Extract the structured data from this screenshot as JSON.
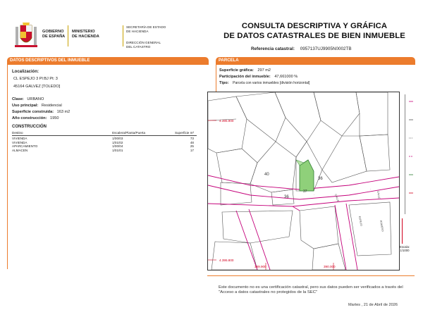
{
  "header": {
    "gobierno": [
      "GOBIERNO",
      "DE ESPAÑA"
    ],
    "ministerio": [
      "MINISTERIO",
      "DE HACIENDA"
    ],
    "secretaria": [
      "SECRETARÍA DE ESTADO",
      "DE HACIENDA"
    ],
    "direccion": [
      "DIRECCIÓN GENERAL",
      "DEL CATASTRO"
    ],
    "title_line1": "CONSULTA DESCRIPTIVA Y GRÁFICA",
    "title_line2": "DE DATOS CATASTRALES DE BIEN INMUEBLE",
    "ref_label": "Referencia catastral:",
    "ref_value": "0957137UJ9905N0002TB"
  },
  "datos": {
    "section_title": "DATOS DESCRIPTIVOS DEL INMUEBLE",
    "localizacion_label": "Localización:",
    "address_line1": "CL ESPEJO 3 Pl:BJ Pt: 3",
    "address_line2": "45164 GALVEZ [TOLEDO]",
    "clase_label": "Clase:",
    "clase_value": "URBANO",
    "uso_label": "Uso principal:",
    "uso_value": "Residencial",
    "superficie_label": "Superficie construida:",
    "superficie_value": "163 m2",
    "anio_label": "Año construcción:",
    "anio_value": "1950",
    "construccion_title": "CONSTRUCCIÓN",
    "table_headers": [
      "Destino",
      "Escalera/Planta/Puerta",
      "Superficie m²"
    ],
    "rows": [
      {
        "destino": "VIVIENDA",
        "epp": "1/00/03",
        "sup": "73"
      },
      {
        "destino": "VIVIENDA",
        "epp": "1/01/02",
        "sup": "48"
      },
      {
        "destino": "APARCAMIENTO",
        "epp": "1/00/04",
        "sup": "25"
      },
      {
        "destino": "ALMACEN",
        "epp": "1/01/01",
        "sup": "17"
      }
    ]
  },
  "parcela": {
    "section_title": "PARCELA",
    "sup_grafica_label": "Superficie gráfica:",
    "sup_grafica_value": "297 m2",
    "participacion_label": "Participación del inmueble:",
    "participacion_value": "47,661000 %",
    "tipo_label": "Tipo:",
    "tipo_value": "Parcela con varios inmuebles [división horizontal]"
  },
  "map": {
    "coord_y_top": "4.395.900",
    "coord_y_bottom": "4.395.800",
    "coord_x_left": "389.900",
    "coord_x_right": "390.000",
    "parcel_labels": [
      "40",
      "36",
      "36",
      "37"
    ],
    "street_labels": [
      "CALLE",
      "ESPEJO",
      "CALLE",
      "ROMERO"
    ],
    "scale_label": "Escala:",
    "scale_value": "1/1000",
    "parcel_color": "#8fd07a",
    "street_color": "#c4007a"
  },
  "footer": {
    "notice": "Este documento no es una certificación catastral, pero sus datos pueden ser verificados a través del \"Acceso a datos catastrales no protegidos de la SEC\"",
    "date": "Martes , 21 de Abril de 2026"
  }
}
